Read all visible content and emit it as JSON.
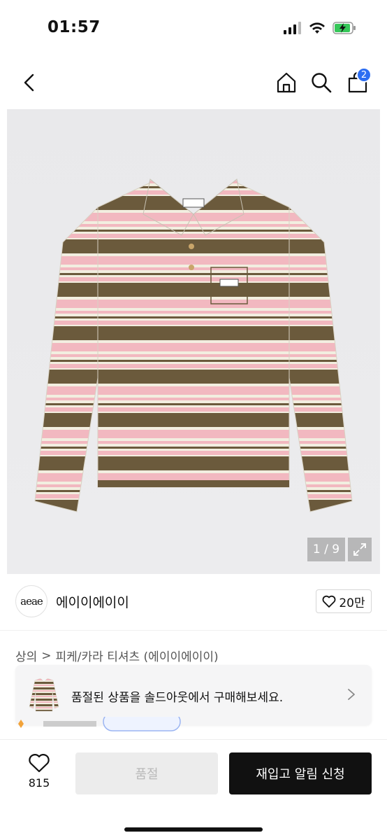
{
  "status_bar": {
    "time": "01:57"
  },
  "nav": {
    "cart_count": "2"
  },
  "gallery": {
    "counter": "1 / 9"
  },
  "brand": {
    "logo_text": "aeae",
    "name": "에이이에이이",
    "like_count": "20만"
  },
  "breadcrumb": {
    "category": "상의",
    "separator": ">",
    "subcategory": "피케/카라 티셔츠 (에이이에이이)"
  },
  "soldout_banner": {
    "text": "품절된 상품을 솔드아웃에서 구매해보세요."
  },
  "bottom_bar": {
    "wish_count": "815",
    "soldout_label": "품절",
    "restock_label": "재입고 알림 신청"
  },
  "colors": {
    "accent": "#2c6df2",
    "stripe_brown": "#6b5a3c",
    "stripe_pink": "#f2b8c0",
    "stripe_cream": "#f2eee0"
  }
}
